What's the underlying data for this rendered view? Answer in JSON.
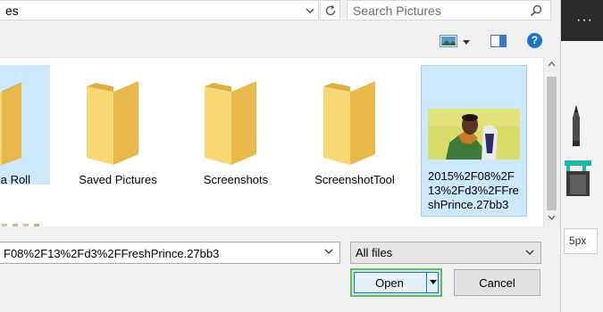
{
  "address": {
    "path": "es"
  },
  "search": {
    "placeholder": "Search Pictures"
  },
  "items": [
    {
      "label": "a Roll"
    },
    {
      "label": "Saved Pictures"
    },
    {
      "label": "Screenshots"
    },
    {
      "label": "ScreenshotTool"
    },
    {
      "label": "2015%2F08%2F13%2Fd3%2FFreshPrince.27bb3"
    }
  ],
  "filename": {
    "value": "F08%2F13%2Fd3%2FFreshPrince.27bb3"
  },
  "filter": {
    "selected": "All files"
  },
  "buttons": {
    "open": "Open",
    "cancel": "Cancel"
  },
  "app": {
    "brush_size": "5px",
    "menu": "···"
  },
  "colors": {
    "selection": "#cce8ff",
    "accent": "#0078d7",
    "folder": "#f8d775"
  }
}
